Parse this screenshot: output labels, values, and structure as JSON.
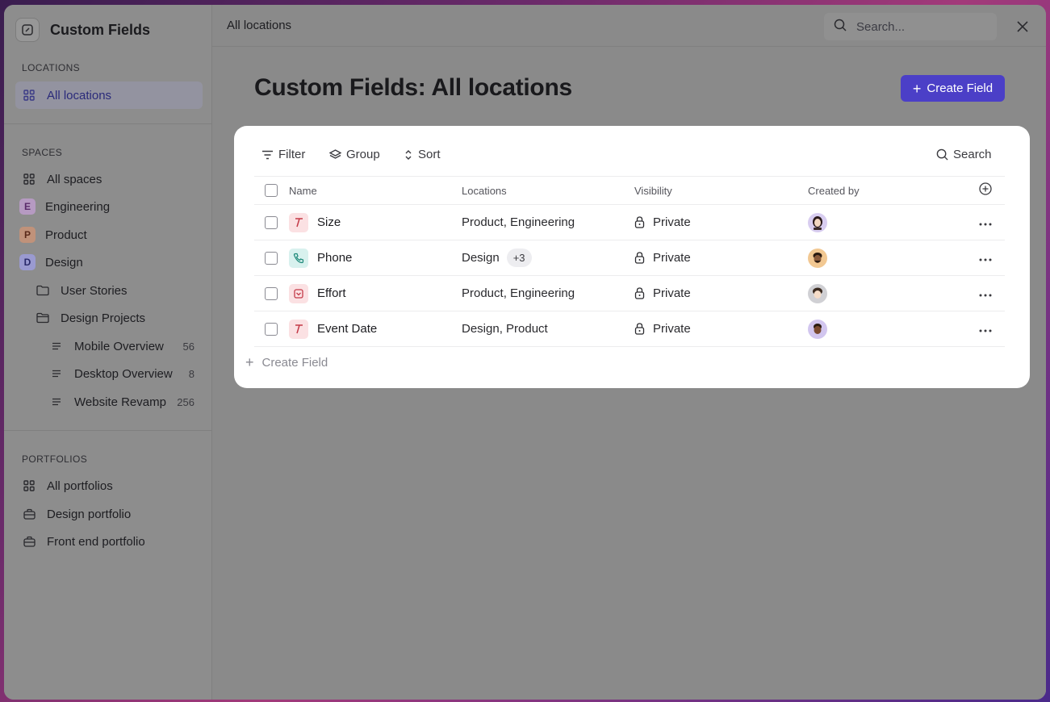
{
  "sidebar": {
    "title": "Custom Fields",
    "sections": {
      "locations": "LOCATIONS",
      "spaces": "SPACES",
      "portfolios": "PORTFOLIOS"
    },
    "locations_items": [
      {
        "label": "All locations",
        "icon": "grid-icon",
        "active": true
      }
    ],
    "spaces_items": [
      {
        "label": "All spaces",
        "icon": "grid-icon"
      },
      {
        "label": "Engineering",
        "letter": "E",
        "color": "#b69ac2"
      },
      {
        "label": "Product",
        "letter": "P",
        "color": "#c0927a"
      },
      {
        "label": "Design",
        "letter": "D",
        "color": "#9a9ad0"
      },
      {
        "label": "User Stories",
        "icon": "folder-icon"
      },
      {
        "label": "Design Projects",
        "icon": "folder-open-icon"
      },
      {
        "label": "Mobile Overview",
        "icon": "list-icon",
        "count": "56"
      },
      {
        "label": "Desktop Overview",
        "icon": "list-icon",
        "count": "8"
      },
      {
        "label": "Website Revamp",
        "icon": "list-icon",
        "count": "256"
      }
    ],
    "portfolios_items": [
      {
        "label": "All portfolios",
        "icon": "grid-icon"
      },
      {
        "label": "Design portfolio",
        "icon": "briefcase-icon"
      },
      {
        "label": "Front end portfolio",
        "icon": "briefcase-icon"
      }
    ]
  },
  "topbar": {
    "breadcrumb": "All locations",
    "search_placeholder": "Search..."
  },
  "main": {
    "page_title": "Custom Fields: All locations",
    "create_button": "Create Field"
  },
  "toolbar": {
    "filter": "Filter",
    "group": "Group",
    "sort": "Sort",
    "search": "Search"
  },
  "table": {
    "headers": {
      "name": "Name",
      "locations": "Locations",
      "visibility": "Visibility",
      "created_by": "Created by"
    },
    "rows": [
      {
        "name": "Size",
        "type_icon": "text-type-icon",
        "locations": "Product, Engineering",
        "extra": "",
        "visibility": "Private",
        "avatar_color": "#d8cdf0"
      },
      {
        "name": "Phone",
        "type_icon": "phone-icon",
        "locations": "Design",
        "extra": "+3",
        "visibility": "Private",
        "avatar_color": "#f2c892"
      },
      {
        "name": "Effort",
        "type_icon": "dropdown-icon",
        "locations": "Product, Engineering",
        "extra": "",
        "visibility": "Private",
        "avatar_color": "#d0d0d4"
      },
      {
        "name": "Event Date",
        "type_icon": "text-type-icon",
        "locations": "Design, Product",
        "extra": "",
        "visibility": "Private",
        "avatar_color": "#d2c6ef"
      }
    ],
    "create_label": "Create Field"
  },
  "colors": {
    "accent": "#4b3fc7",
    "active_item_text": "#2a2a7a"
  }
}
